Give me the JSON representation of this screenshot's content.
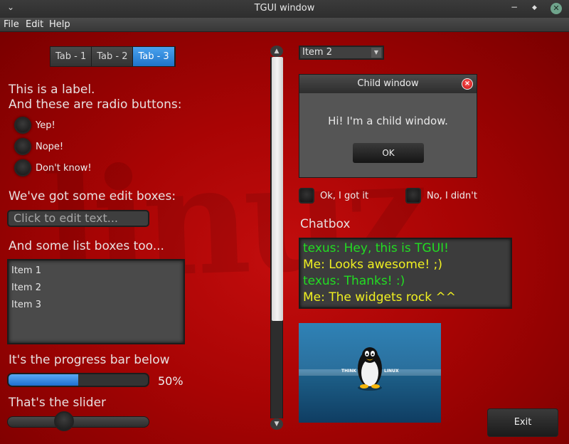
{
  "window": {
    "title": "TGUI window",
    "controls": {
      "minimize": "−",
      "maximize": "◆",
      "close": "✕"
    }
  },
  "menu": {
    "items": [
      "File",
      "Edit",
      "Help"
    ]
  },
  "tabs": {
    "items": [
      "Tab - 1",
      "Tab - 2",
      "Tab - 3"
    ],
    "selected": 2
  },
  "labels": {
    "label_line1": "This is a label.",
    "label_line2": "And these are radio buttons:",
    "edit_heading": "We've got some edit boxes:",
    "list_heading": "And some list boxes too...",
    "progress_heading": "It's the progress bar below",
    "slider_heading": "That's the slider",
    "chatbox_heading": "Chatbox"
  },
  "radio_buttons": [
    "Yep!",
    "Nope!",
    "Don't know!"
  ],
  "editbox": {
    "placeholder": "Click to edit text...",
    "value": ""
  },
  "listbox": {
    "items": [
      "Item 1",
      "Item 2",
      "Item 3"
    ]
  },
  "progress": {
    "value": 0.5,
    "text": "50%"
  },
  "slider": {
    "value": 0.4
  },
  "scrollbar": {
    "position": 0,
    "visible_fraction": 0.73
  },
  "combobox": {
    "selected": "Item 2"
  },
  "child_window": {
    "title": "Child window",
    "message": "Hi! I'm a child window.",
    "ok_label": "OK"
  },
  "checkboxes": [
    "Ok, I got it",
    "No, I didn't"
  ],
  "chatbox": {
    "lines": [
      {
        "text": "texus: Hey, this is TGUI!",
        "color": "#22dd22"
      },
      {
        "text": "Me: Looks awesome! ;)",
        "color": "#f0f020"
      },
      {
        "text": "texus: Thanks! :)",
        "color": "#22dd22"
      },
      {
        "text": "Me: The widgets rock ^^",
        "color": "#f0f020"
      }
    ]
  },
  "picture": {
    "text_left": "THINK",
    "text_right": "LINUX"
  },
  "exit_button": {
    "label": "Exit"
  },
  "colors": {
    "background": "#a80404",
    "accent": "#1f73c9",
    "widget": "#3c3c3c"
  }
}
